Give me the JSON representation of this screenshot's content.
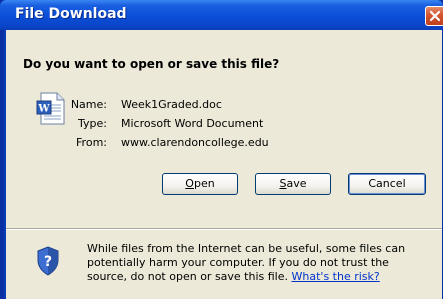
{
  "title": "File Download",
  "question": "Do you want to open or save this file?",
  "file": {
    "icon": "word-doc-icon",
    "name_label": "Name:",
    "name_value": "Week1Graded.doc",
    "type_label": "Type:",
    "type_value": "Microsoft Word Document",
    "from_label": "From:",
    "from_value": "www.clarendoncollege.edu"
  },
  "buttons": {
    "open_prefix": "",
    "open_mnemonic": "O",
    "open_rest": "pen",
    "save_prefix": "",
    "save_mnemonic": "S",
    "save_rest": "ave",
    "cancel": "Cancel"
  },
  "warning": {
    "text": "While files from the Internet can be useful, some files can potentially harm your computer. If you do not trust the source, do not open or save this file.",
    "link": "What's the risk?"
  },
  "colors": {
    "titlebar": "#0b4ed8",
    "close": "#c13f1e",
    "dialog_bg": "#ece9d8",
    "link": "#0033cc"
  }
}
